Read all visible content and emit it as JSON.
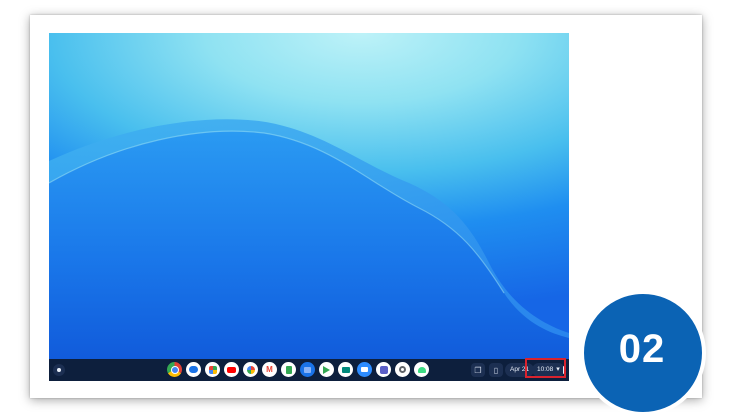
{
  "shelf": {
    "launcher_icon": "launcher-circle-icon",
    "pinned_apps": [
      {
        "name": "chrome-icon",
        "color": "#e04136"
      },
      {
        "name": "messages-icon",
        "color": "#1a73e8"
      },
      {
        "name": "maps-icon",
        "color": "#34a853"
      },
      {
        "name": "youtube-icon",
        "color": "#ff0000"
      },
      {
        "name": "photos-icon",
        "color": "#fbbc05"
      },
      {
        "name": "gmail-icon",
        "color": "#ffffff"
      },
      {
        "name": "sheets-icon",
        "color": "#34a853"
      },
      {
        "name": "files-icon",
        "color": "#1a73e8"
      },
      {
        "name": "play-store-icon",
        "color": "#34a853"
      },
      {
        "name": "meet-icon",
        "color": "#00897b"
      },
      {
        "name": "zoom-icon",
        "color": "#2d8cff"
      },
      {
        "name": "teams-icon",
        "color": "#5b5fc7"
      },
      {
        "name": "settings-icon",
        "color": "#9aa0a6"
      },
      {
        "name": "android-icon",
        "color": "#3ddc84"
      }
    ],
    "date": "Apr 21",
    "time": "10:08",
    "wifi_icon": "wifi-icon",
    "battery_icon": "battery-icon"
  },
  "badge": {
    "number": "02",
    "color": "#0b63b4"
  },
  "highlight_color": "#d9232e"
}
